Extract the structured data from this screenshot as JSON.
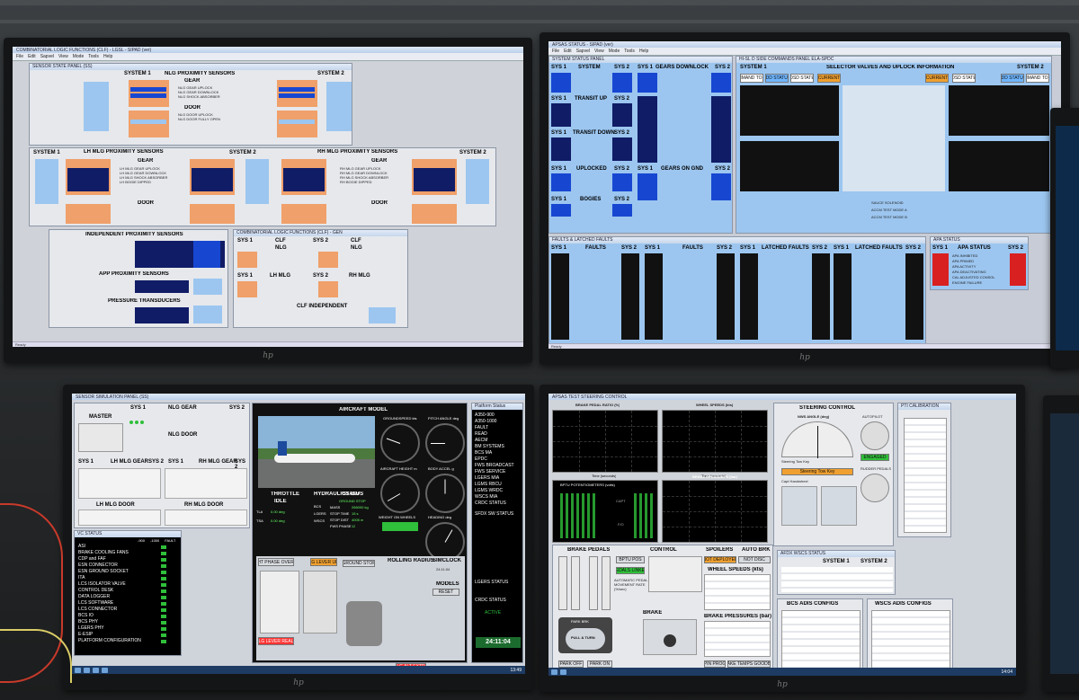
{
  "tl": {
    "window_title": "COMBINATORIAL LOGIC FUNCTIONS (CLF) - LGSL - SIPAD (ver)",
    "menu": [
      "File",
      "Edit",
      "Sapvel",
      "View",
      "Mode",
      "Tools",
      "Help"
    ],
    "panel_title": "SENSOR STATE PANEL (SS)",
    "nlg_header": "NLG PROXIMITY SENSORS",
    "sys1": "SYSTEM 1",
    "sys2": "SYSTEM 2",
    "gear": "GEAR",
    "door": "DOOR",
    "lh_header": "LH MLG PROXIMITY SENSORS",
    "rh_header": "RH MLG PROXIMITY SENSORS",
    "indep_header": "INDEPENDENT PROXIMITY SENSORS",
    "app_header": "APP PROXIMITY SENSORS",
    "pressure_header": "PRESSURE TRANSDUCERS",
    "clf_title": "COMBINATORIAL LOGIC FUNCTIONS (CLF) - GEN",
    "clf": "CLF",
    "nlg": "NLG",
    "lh_mlg": "LH MLG",
    "rh_mlg": "RH MLG",
    "clf_indep": "CLF INDEPENDENT",
    "clf_sys1": "SYS 1",
    "clf_sys2": "SYS 2",
    "nlg_labels": [
      "NLG GEAR UPLOCK",
      "NLG GEAR DOWNLOCK",
      "NLG SHOCK ABSORBER"
    ],
    "door_labels": [
      "NLG DOOR UPLOCK",
      "NLG DOOR FULLY OPEN"
    ],
    "lh_labels": [
      "LH MLG GEAR UPLOCK",
      "LH MLG GEAR DOWNLOCK",
      "LH MLG SHOCK ABSORBER",
      "LH BOGIE DIPPED"
    ],
    "rh_labels": [
      "RH MLG GEAR UPLOCK",
      "RH MLG GEAR DOWNLOCK",
      "RH MLG SHOCK ABSORBER",
      "RH BOGIE DIPPED"
    ],
    "status": "Ready"
  },
  "tr": {
    "window_title": "APSAS STATUS - SIPAD (ver)",
    "menu": [
      "File",
      "Edit",
      "Sapvel",
      "View",
      "Mode",
      "Tools",
      "Help"
    ],
    "status_panel": "SYSTEM STATUS PANEL",
    "sys1": "SYS 1",
    "sys2": "SYS 2",
    "system": "SYSTEM",
    "gears_downlock": "GEARS DOWNLOCK",
    "transit_up": "TRANSIT UP",
    "transit_down": "TRANSIT DOWN",
    "uplocked": "UPLOCKED",
    "gears_on_gnd": "GEARS ON GND",
    "bogies": "BOGIES",
    "selector_header": "SELECTOR VALVES AND UPLOCK INFORMATION",
    "selector_title": "HI-SL D SIDE COMMANDS PANEL ELA-SPDC",
    "system1": "SYSTEM 1",
    "system2": "SYSTEM 2",
    "command_to_ldd": "COMMAND TO LDD",
    "ldd_status": "LDD STATUS",
    "dsd_state": "DSD STATE",
    "current": "CURRENT",
    "faults_title": "FAULTS & LATCHED FAULTS",
    "faults": "FAULTS",
    "latched_faults": "LATCHED FAULTS",
    "apa_title": "APA STATUS",
    "apa_status": "APA STATUS",
    "sauce": "SAUCE SOLENOID",
    "acm_a": "ACCM TEST MODE A",
    "acm_b": "ACCM TEST MODE B",
    "apa_items": [
      "APA INHIBITED",
      "APA PRIMED",
      "APA ACTIVITY",
      "APA DEACTIVATING",
      "CAL ADJUSTED CONSOL",
      "ENGINE FAILURE"
    ],
    "status": "Ready"
  },
  "bl": {
    "window_title": "SENSOR SIMULATION PANEL (SS)",
    "master": "MASTER",
    "sys1": "SYS 1",
    "sys2": "SYS 2",
    "nlg_gear": "NLG GEAR",
    "nlg_door": "NLG DOOR",
    "lh_mlg_gear": "LH MLG GEAR",
    "rh_mlg_gear": "RH MLG GEAR",
    "lh_mlg_door": "LH MLG DOOR",
    "rh_mlg_door": "RH MLG DOOR",
    "aircraft_model": "AIRCRAFT MODEL",
    "groundspeed": "GROUNDSPEED kts",
    "pitch_angle": "PITCH ANGLE deg",
    "aircraft_height": "AIRCRAFT HEIGHT m",
    "body_accel": "BODY ACCEL g",
    "weight_on_wheels": "WEIGHT ON WHEELS",
    "heading": "HEADING deg",
    "throttle": "THROTTLE",
    "throttle_state": "IDLE",
    "hydraulics": "HYDRAULICS Bar",
    "status_hdr": "STATUS",
    "ground_stop": "GROUND STOP",
    "tla": "TLA",
    "tla_val": "0.00 deg",
    "tsa": "TSA",
    "mass": "MASS",
    "mass_val": "266000 kg",
    "stop_time": "STOP TIME",
    "stop_time_val": "15 s",
    "stop_dist": "STOP DIST",
    "stop_dist_val": "4005 m",
    "fws_phase": "FWS PHASE",
    "fws_phase_val": "12",
    "bcs": "BCS",
    "lgers": "LGERS",
    "wscs": "WSCS",
    "platform_status": "Platform Status",
    "plat_items": [
      "A350-900",
      "A350-1000",
      "FAULT",
      "READ",
      "AECM",
      "BM SYSTEMS",
      "BCS MA",
      "EPDC",
      "FWS BROADCAST",
      "FWS SERVICE",
      "LGERS MIA",
      "LGMS RBCU",
      "LGMS WRDC",
      "WSCS MIA",
      "CRDC STATUS"
    ],
    "fdx_status": "SFDX SW STATUS",
    "crdc_status": "CRDC STATUS",
    "active": "ACTIVE",
    "lgers_status": "LGERS STATUS",
    "time": "24:11:04",
    "rolling_radius": "ROLLING RADIUS",
    "simclock": "SIMCLOCK",
    "simclock_val": "24:11:04",
    "models": "MODELS",
    "reset": "RESET",
    "gear_lever_up": "LG LEVER UP",
    "gear_lever_real": "LG LEVER REAL",
    "flight_phase_override": "FLIGHT PHASE OVERRIDE",
    "vc_title": "VC STATUS",
    "vc_cols": [
      "-900",
      "-1000",
      "FAULT"
    ],
    "vc_items": [
      "ASI",
      "BRAKE COOLING FANS",
      "CDP and FAF",
      "ESN CONNECTOR",
      "ESN GROUND SOCKET",
      "ITA",
      "LCS ISOLATOR VALVE",
      "CONTROL DESK",
      "DATA LOGGER",
      "LCS SOFTWARE",
      "LCS CONNECTOR",
      "BCS IO",
      "BCS PHY",
      "LGERS PHY",
      "E-ESIP",
      "PLATFORM CONFIGURATION"
    ],
    "lg_alt_extr": "LG ALT EXTR",
    "clock": "13:49"
  },
  "br": {
    "window_title": "APSAS TEST STEERING CONTROL",
    "brake_pedal_ratio": "BRAKE PEDAL RATIO (%)",
    "wheel_speeds": "WHEEL SPEEDS (kts)",
    "time_seconds": "Time (seconds)",
    "bptu": "BPTU POTENTIOMETERS (volts)",
    "brake_pressures": "BRAKE PRESSURES (bar)",
    "capt": "CAPT",
    "fo": "F/O",
    "steering_control": "STEERING CONTROL",
    "nws_angle": "NWS ANGLE (deg)",
    "autopilot": "AUTOPILOT",
    "engaged": "ENGAGED",
    "rudder_pedals": "RUDDER PEDALS",
    "steering_tow_key": "Steering Tow Key",
    "handwheel": "Capt Handwheel",
    "brake_pedals": "BRAKE PEDALS",
    "control": "CONTROL",
    "spoilers": "SPOILERS",
    "auto_brk": "AUTO BRK",
    "bptu_pos": "BPTU POS",
    "pedals_linked": "PEDALS LINKED",
    "auto_pedal_movement": "AUTOMATIC PEDAL MOVEMENT RATE (%/sec)",
    "wheel_speeds_sim": "WHEEL SPEEDS (kts)",
    "brake_pressures_bar": "BRAKE PRESSURES (bar)",
    "brake": "BRAKE",
    "park_brk": "PARK BRK",
    "pull_turn": "PULL & TURN",
    "not_deployed": "NOT DEPLOYED",
    "not_disc": "NOT DISC",
    "ptu_cal": "PTI CALIBRATION",
    "bcs_adis": "BCS ADIS CONFIGS",
    "wscs_adis": "WSCS ADIS CONFIGS",
    "wscs_status": "AFDX WSCS STATUS",
    "system1": "SYSTEM 1",
    "system2": "SYSTEM 2",
    "brake_temps": "BRAKE TEMPS GOODBOX",
    "pin_prog": "PIN PROG",
    "park_off": "PARK OFF",
    "park_on": "PARK ON",
    "clock": "14:04"
  }
}
